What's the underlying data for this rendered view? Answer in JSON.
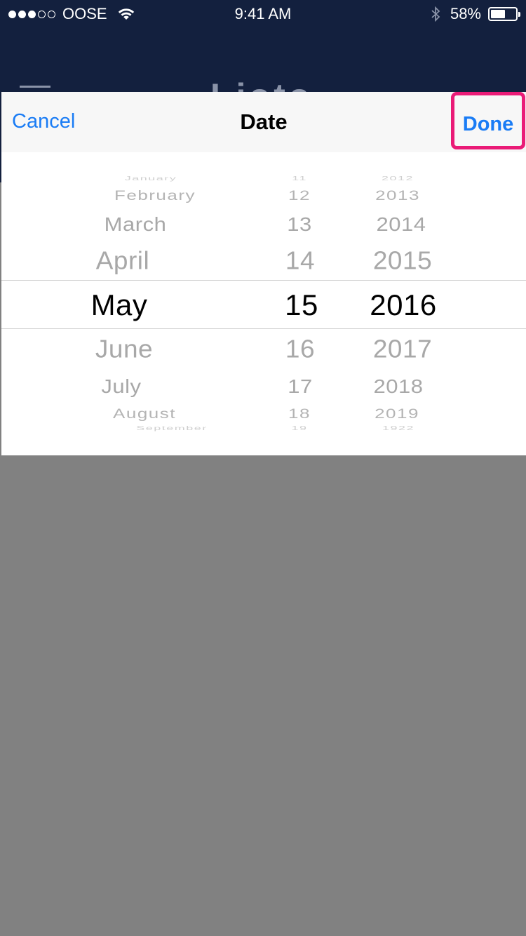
{
  "status_bar": {
    "carrier": "OOSE",
    "time": "9:41 AM",
    "battery_percent": "58%",
    "signal_bars_filled": 3,
    "signal_bars_total": 5,
    "battery_level": 0.58
  },
  "background_nav": {
    "title": "Lists"
  },
  "toolbar": {
    "cancel_label": "Cancel",
    "title": "Date",
    "done_label": "Done"
  },
  "picker": {
    "months": [
      "January",
      "February",
      "March",
      "April",
      "May",
      "June",
      "July",
      "August",
      "September"
    ],
    "days": [
      "11",
      "12",
      "13",
      "14",
      "15",
      "16",
      "17",
      "18",
      "19"
    ],
    "years": [
      "2012",
      "2013",
      "2014",
      "2015",
      "2016",
      "2017",
      "2018",
      "2019",
      "1922"
    ],
    "selected": {
      "month": "May",
      "day": "15",
      "year": "2016"
    }
  },
  "colors": {
    "nav_background": "#13203e",
    "accent": "#1a7cf5",
    "highlight": "#ea1b77",
    "overlay": "#818181"
  }
}
